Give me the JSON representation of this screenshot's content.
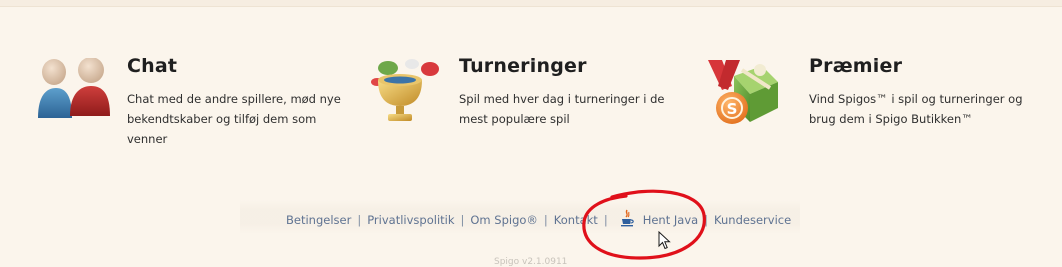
{
  "features": [
    {
      "title": "Chat",
      "text": "Chat med de andre spillere, mød nye bekendtskaber og tilføj dem som venner",
      "icon": "chat-people-icon"
    },
    {
      "title": "Turneringer",
      "text": "Spil med hver dag i turneringer i de mest populære spil",
      "icon": "trophy-icon"
    },
    {
      "title": "Præmier",
      "text": "Vind Spigos™ i spil og turneringer og brug dem i Spigo Butikken™",
      "icon": "prize-gift-medal-icon"
    }
  ],
  "footer": {
    "links": [
      "Betingelser",
      "Privatlivspolitik",
      "Om Spigo®",
      "Kontakt",
      "Hent Java",
      "Kundeservice"
    ],
    "separator": "|",
    "version": "Spigo v2.1.0911"
  },
  "colors": {
    "background": "#fbf5ec",
    "link": "#5f7392",
    "annotation": "#e0101a"
  }
}
